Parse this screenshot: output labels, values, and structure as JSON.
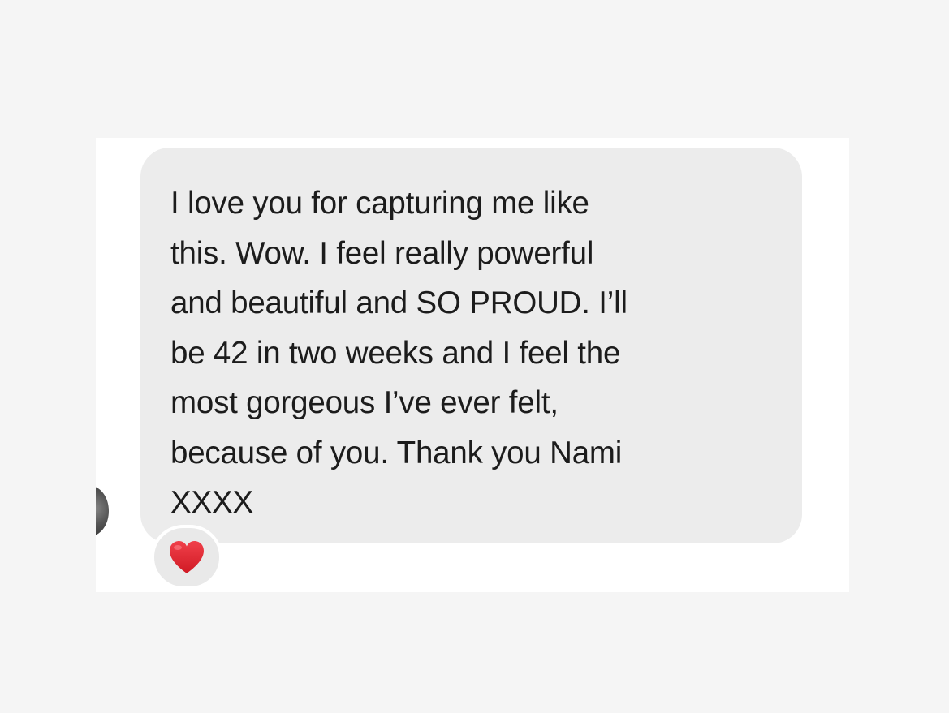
{
  "conversation": {
    "message": {
      "lines": [
        "I love you for capturing me like",
        "this. Wow. I feel really powerful",
        "and beautiful and SO PROUD. I’ll",
        "be 42 in two weeks and I feel the",
        "most gorgeous I’ve ever felt,",
        "because of you. Thank you Nami",
        "XXXX"
      ],
      "bubble_color": "#ececec",
      "text_color": "#1c1c1c"
    },
    "reaction": {
      "icon": "red-heart-icon",
      "color": "#e0242c"
    },
    "sender_avatar": {
      "icon": "avatar"
    }
  }
}
